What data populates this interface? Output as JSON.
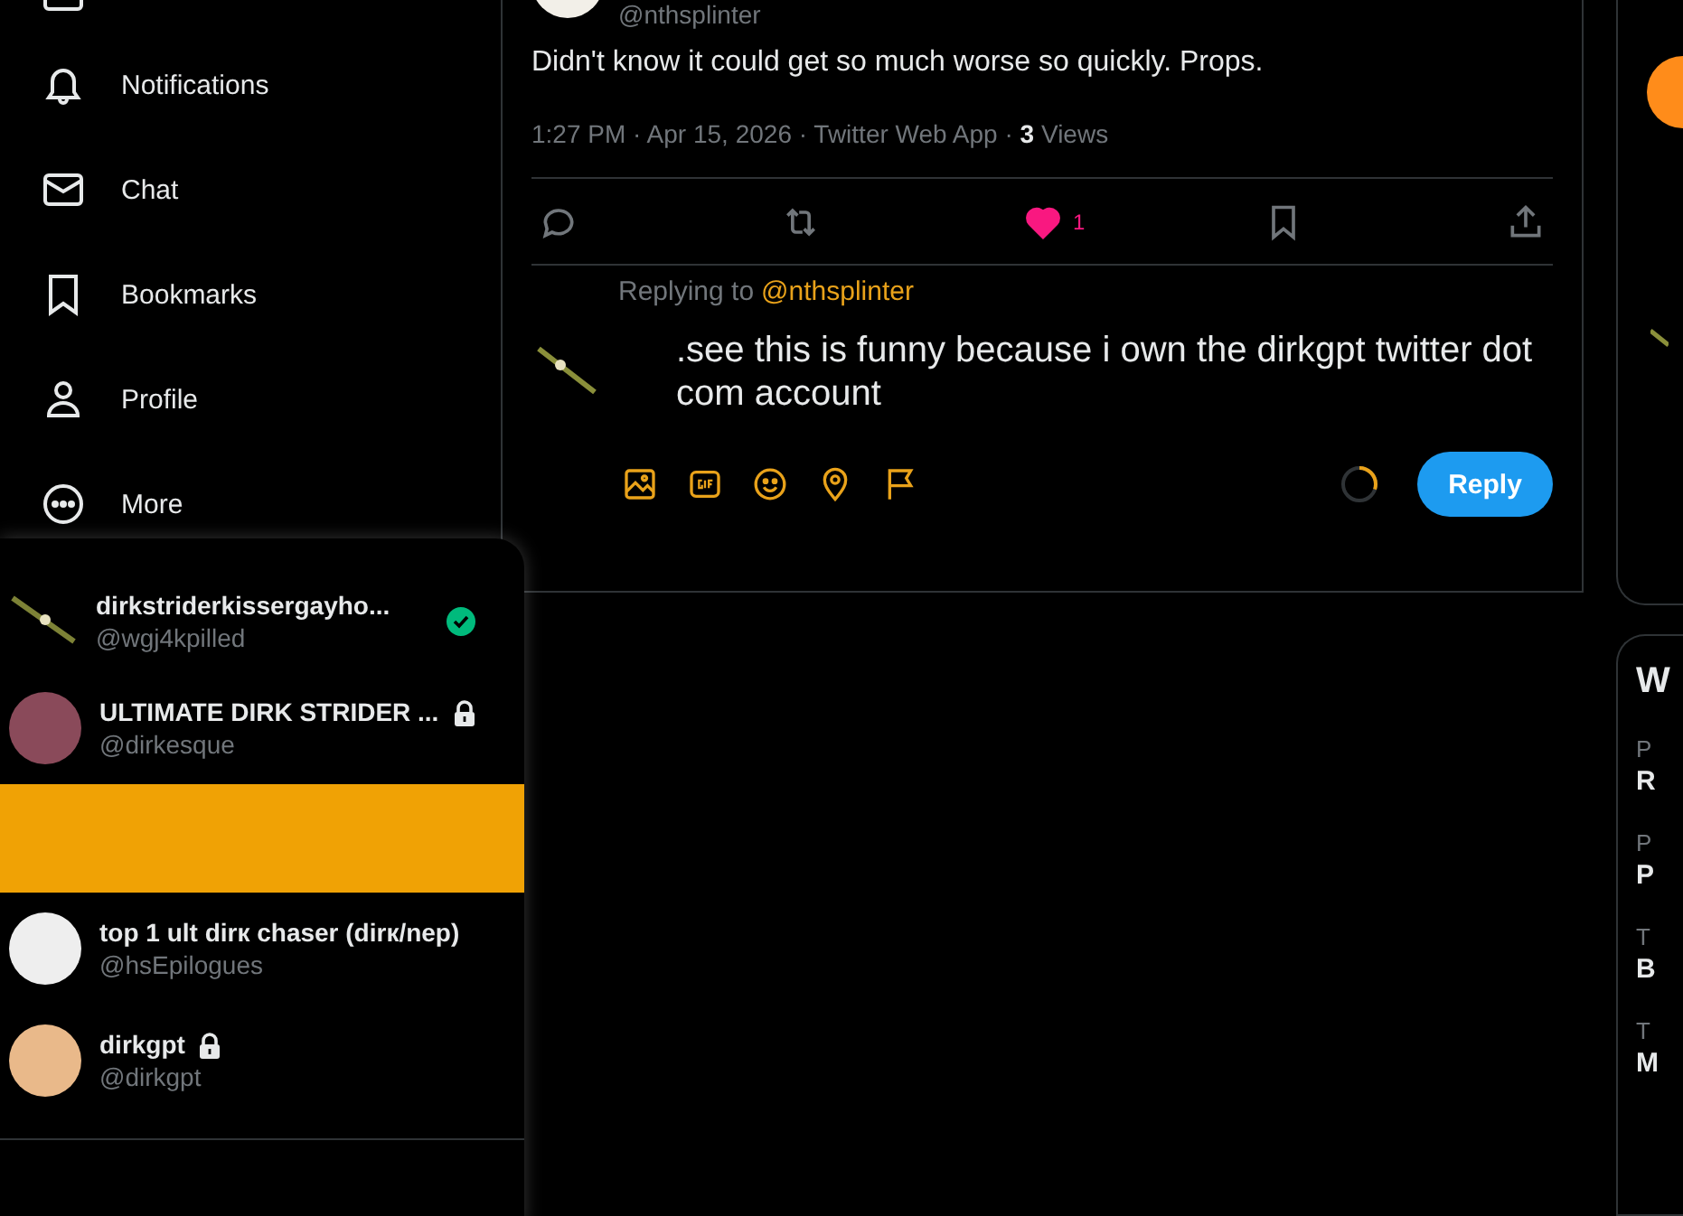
{
  "sidebar": {
    "items": [
      {
        "kind": "bell",
        "label": "Notifications"
      },
      {
        "kind": "mail",
        "label": "Chat"
      },
      {
        "kind": "bookmark",
        "label": "Bookmarks"
      },
      {
        "kind": "person",
        "label": "Profile"
      },
      {
        "kind": "more",
        "label": "More"
      }
    ]
  },
  "account_switcher": {
    "accounts": [
      {
        "kind": "account",
        "avatar": {
          "kind": "sword"
        },
        "name": "dirkstriderkissergayho...",
        "handle": "@wgj4kpilled",
        "badge": {
          "kind": "verified"
        }
      },
      {
        "kind": "account",
        "avatar": {
          "kind": "photo"
        },
        "name": "ULTIMATE DIRK STRIDER ...",
        "handle": "@dirkesque",
        "badge": {
          "kind": "locked"
        }
      },
      {
        "kind": "highlight"
      },
      {
        "kind": "account",
        "avatar": {
          "kind": "photo"
        },
        "name": "top 1 ult dirк chaser (dirк/nep)",
        "handle": "@hsEpilogues"
      },
      {
        "kind": "account",
        "avatar": {
          "kind": "photo"
        },
        "name": "dirkgpt",
        "handle": "@dirkgpt",
        "badge": {
          "kind": "locked"
        }
      }
    ]
  },
  "tweet": {
    "handle": "@nthsplinter",
    "text": "Didn't know it could get so much worse so quickly. Props.",
    "meta": "1:27 PM · Apr 15, 2026 · Twitter Web App · **3** Views",
    "actions": [
      {
        "kind": "reply",
        "active": false
      },
      {
        "kind": "retweet",
        "active": false
      },
      {
        "kind": "like",
        "active": true,
        "count": "1"
      },
      {
        "kind": "bookmark",
        "active": false
      },
      {
        "kind": "share",
        "active": false
      }
    ]
  },
  "composer": {
    "replying_to": "Replying to",
    "mention": "@nthsplinter",
    "value": ".see this is funny because i own the dirkgpt twitter dot com account",
    "tools": [
      {
        "kind": "image"
      },
      {
        "kind": "gif"
      },
      {
        "kind": "emoji"
      },
      {
        "kind": "location"
      },
      {
        "kind": "flag"
      }
    ],
    "level": 0.3,
    "button": "Reply"
  },
  "right_column": {
    "heading": "W",
    "trends": [
      {
        "context": "P",
        "title": "R"
      },
      {
        "context": "P",
        "title": "P"
      },
      {
        "context": "T",
        "title": "B"
      },
      {
        "context": "T",
        "title": "M"
      }
    ]
  }
}
